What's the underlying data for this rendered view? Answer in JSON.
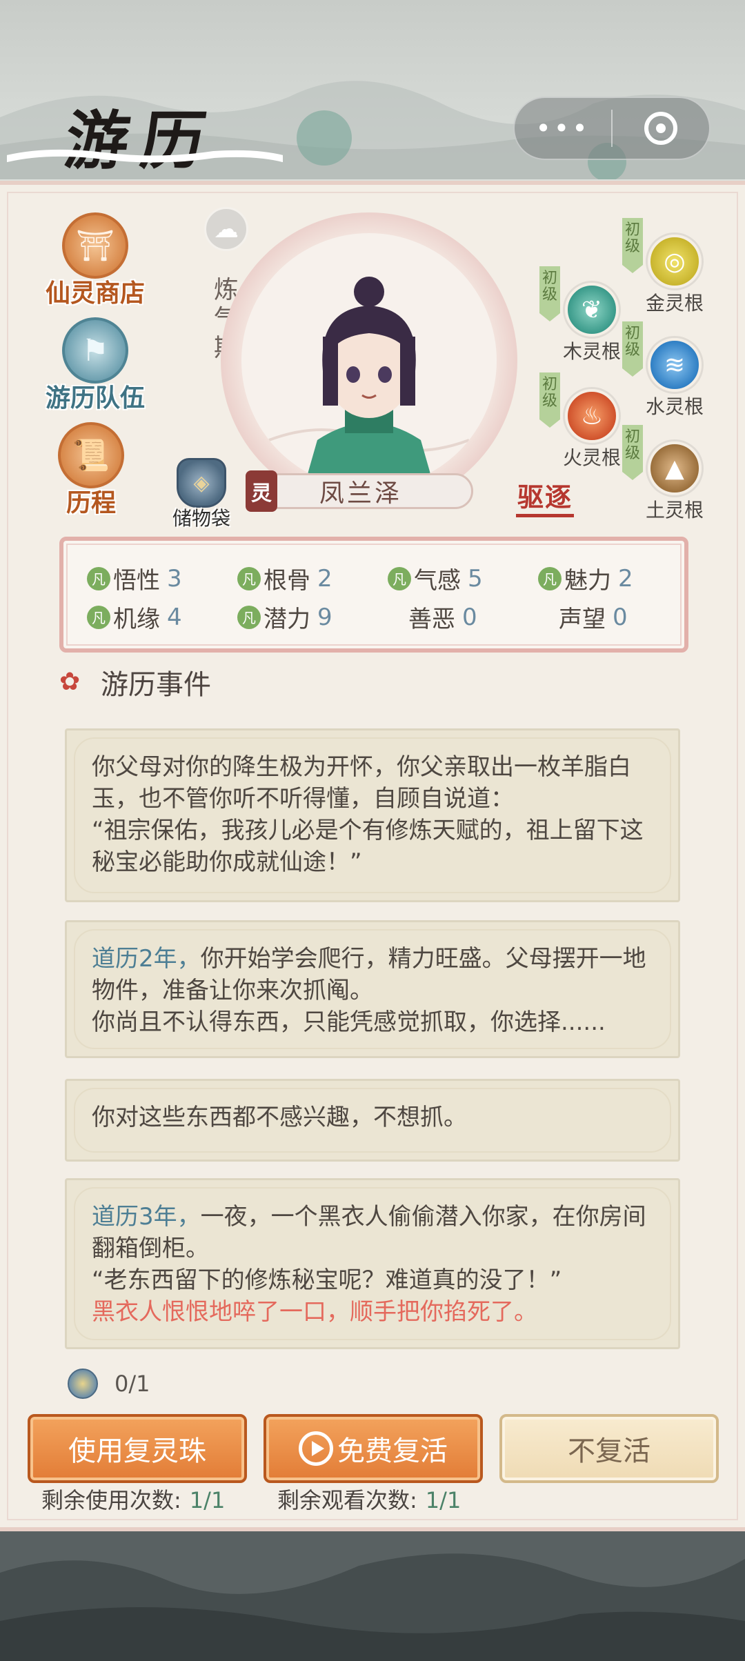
{
  "header": {
    "title": "游历"
  },
  "capsule": {
    "more_icon": "more-dots-icon",
    "close_icon": "target-ring-icon"
  },
  "side_menu": [
    {
      "label": "仙灵商店",
      "icon": "shop-icon"
    },
    {
      "label": "游历队伍",
      "icon": "team-icon"
    },
    {
      "label": "历程",
      "icon": "scroll-icon"
    }
  ],
  "character": {
    "realm": "炼气期",
    "name_badge": "灵",
    "name": "凤兰泽",
    "expel_label": "驱逐",
    "bag_label": "储物袋"
  },
  "spirit_roots": [
    {
      "label": "金灵根",
      "grade": "初级",
      "color": "#c9b52e",
      "icon": "gold-swirl-icon"
    },
    {
      "label": "木灵根",
      "grade": "初级",
      "color": "#3a9a8a",
      "icon": "leaf-icon"
    },
    {
      "label": "水灵根",
      "grade": "初级",
      "color": "#2f7fc4",
      "icon": "wave-icon"
    },
    {
      "label": "火灵根",
      "grade": "初级",
      "color": "#d0522c",
      "icon": "flame-icon"
    },
    {
      "label": "土灵根",
      "grade": "初级",
      "color": "#9a6f3c",
      "icon": "mountain-icon"
    }
  ],
  "stats": [
    {
      "mark": "凡",
      "label": "悟性",
      "value": "3"
    },
    {
      "mark": "凡",
      "label": "根骨",
      "value": "2"
    },
    {
      "mark": "凡",
      "label": "气感",
      "value": "5"
    },
    {
      "mark": "凡",
      "label": "魅力",
      "value": "2"
    },
    {
      "mark": "凡",
      "label": "机缘",
      "value": "4"
    },
    {
      "mark": "凡",
      "label": "潜力",
      "value": "9"
    },
    {
      "mark": "",
      "label": "善恶",
      "value": "0"
    },
    {
      "mark": "",
      "label": "声望",
      "value": "0"
    }
  ],
  "events_title": "游历事件",
  "events": [
    {
      "year": "",
      "text": "你父母对你的降生极为开怀，你父亲取出一枚羊脂白玉，也不管你听不听得懂，自顾自说道：\n“祖宗保佑，我孩儿必是个有修炼天赋的，祖上留下这秘宝必能助你成就仙途！”",
      "death": ""
    },
    {
      "year": "道历2年，",
      "text": "你开始学会爬行，精力旺盛。父母摆开一地物件，准备让你来次抓阄。\n你尚且不认得东西，只能凭感觉抓取，你选择......",
      "death": ""
    },
    {
      "year": "",
      "text": "你对这些东西都不感兴趣，不想抓。",
      "death": ""
    },
    {
      "year": "道历3年，",
      "text": "一夜，一个黑衣人偷偷潜入你家，在你房间翻箱倒柜。\n“老东西留下的修炼秘宝呢？难道真的没了！”",
      "death": "黑衣人恨恨地啐了一口，顺手把你掐死了。"
    }
  ],
  "revive": {
    "pearl_count": "0/1",
    "use_pearl_label": "使用复灵珠",
    "free_revive_label": "免费复活",
    "no_revive_label": "不复活",
    "remain_use_label": "剩余使用次数:",
    "remain_use_value": "1/1",
    "remain_watch_label": "剩余观看次数:",
    "remain_watch_value": "1/1"
  }
}
